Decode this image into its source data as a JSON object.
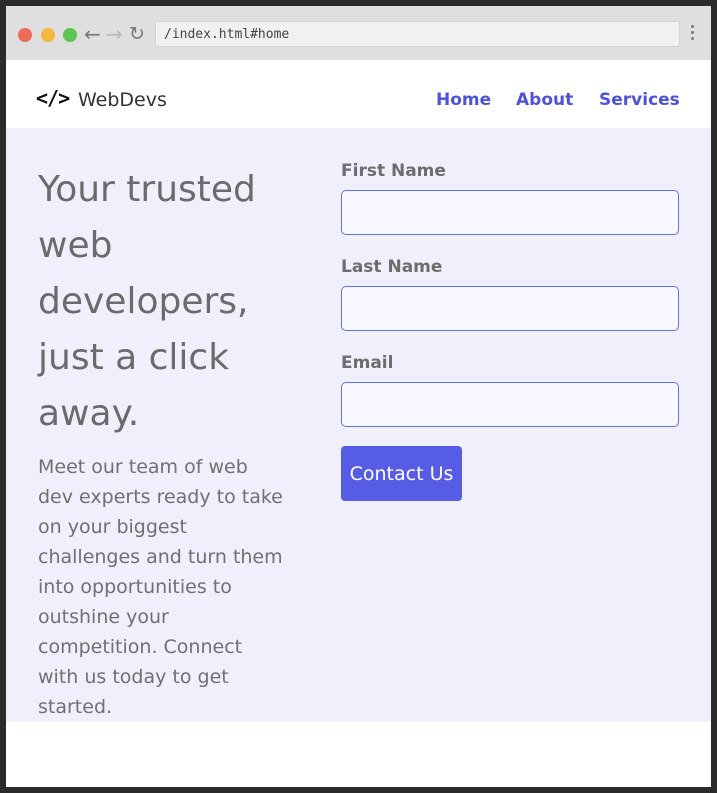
{
  "browser": {
    "url": "/index.html#home",
    "back_icon": "arrow-left-icon",
    "forward_icon": "arrow-right-icon",
    "reload_icon": "reload-icon",
    "menu_icon": "kebab-menu-icon"
  },
  "header": {
    "logo_glyph": "</>",
    "brand": "WebDevs",
    "nav": {
      "home": "Home",
      "about": "About",
      "services": "Services"
    }
  },
  "hero": {
    "title": "Your trusted web developers, just a click away.",
    "description": "Meet our team of web dev experts ready to take on your biggest challenges and turn them into opportunities to outshine your competition. Connect with us today to get started."
  },
  "form": {
    "first_name_label": "First Name",
    "first_name_value": "",
    "last_name_label": "Last Name",
    "last_name_value": "",
    "email_label": "Email",
    "email_value": "",
    "submit_label": "Contact Us"
  },
  "colors": {
    "accent": "#575ce4",
    "nav_link": "#4d52d6",
    "hero_bg": "#f0f0fd",
    "input_border": "#6a6fe0"
  }
}
